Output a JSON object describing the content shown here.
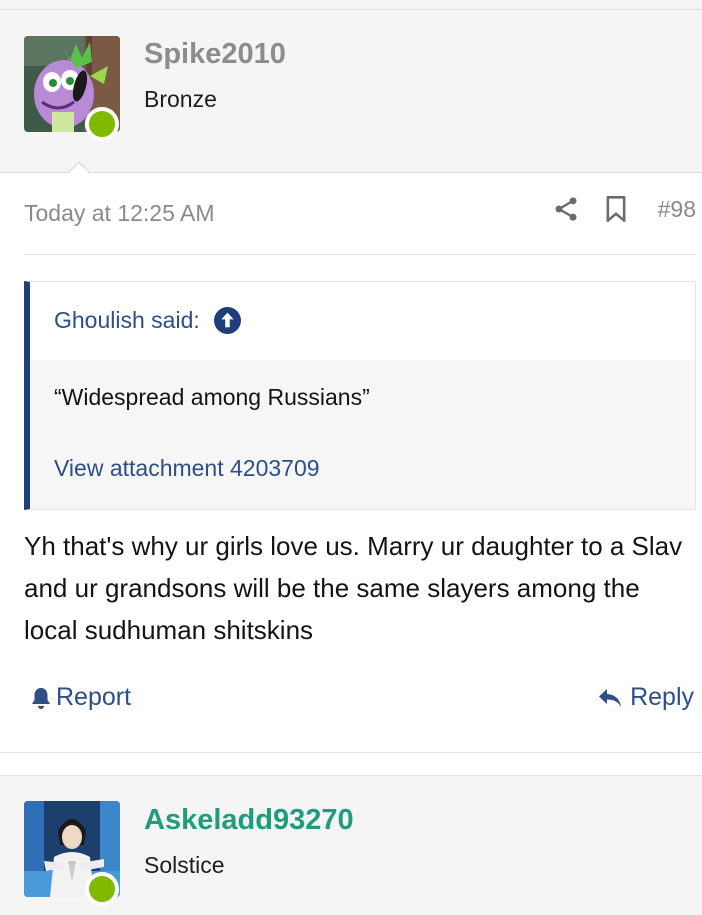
{
  "posts": [
    {
      "username": "Spike2010",
      "user_title": "Bronze",
      "date": "Today at 12:25 AM",
      "number": "#98",
      "quote": {
        "author": "Ghoulish said:",
        "text": "“Widespread among Russians”",
        "link": "View attachment 4203709"
      },
      "body": "Yh that's why ur girls love us. Marry ur daughter to a Slav and ur grandsons will be the same slayers among the local sudhuman shitskins",
      "actions": {
        "report": "Report",
        "reply": "Reply"
      },
      "status": "online"
    },
    {
      "username": "Askeladd93270",
      "user_title": "Solstice",
      "status": "online"
    }
  ],
  "colors": {
    "link": "#2d4f86",
    "quote_border": "#1f3f7a",
    "online": "#7fba00",
    "username_gray": "#8c8c8c",
    "username_teal": "#1f9b7e"
  },
  "icons": [
    "share-icon",
    "bookmark-icon",
    "arrow-up-circle-icon",
    "bell-icon",
    "reply-icon"
  ]
}
